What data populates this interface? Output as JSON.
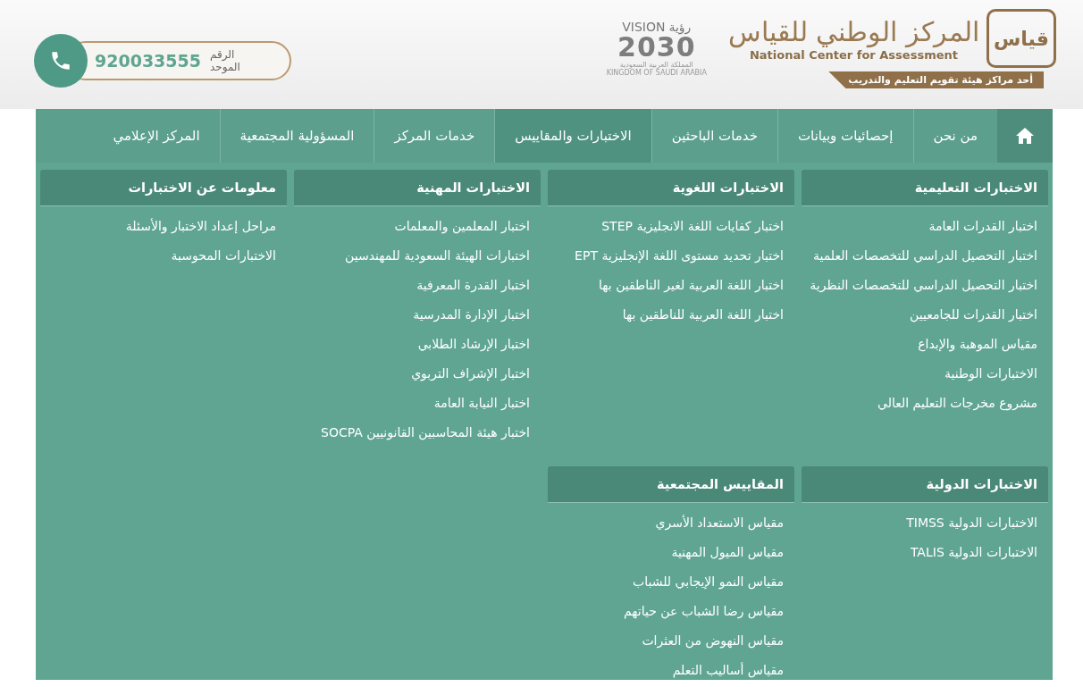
{
  "header": {
    "phone": {
      "label": "الرقم الموحد",
      "number": "920033555"
    },
    "vision": {
      "word_en": "VISION",
      "word_ar": "رؤية",
      "year": "2030",
      "country_ar": "المملكة العربية السعودية",
      "country_en": "KINGDOM OF SAUDI ARABIA"
    },
    "logo": {
      "mark": "قياس",
      "name_ar": "المركز الوطني للقياس",
      "name_en": "National Center for Assessment",
      "tagline": "أحد مراكز هيئة تقويم التعليم والتدريب"
    }
  },
  "nav": {
    "items": [
      {
        "label": "من نحن",
        "selected": false
      },
      {
        "label": "إحصائيات وبيانات",
        "selected": false
      },
      {
        "label": "خدمات الباحثين",
        "selected": false
      },
      {
        "label": "الاختبارات والمقاييس",
        "selected": true
      },
      {
        "label": "خدمات المركز",
        "selected": false
      },
      {
        "label": "المسؤولية المجتمعية",
        "selected": false
      },
      {
        "label": "المركز الإعلامي",
        "selected": false
      }
    ]
  },
  "mega_menu": {
    "sections": [
      {
        "title": "الاختبارات التعليمية",
        "items": [
          "اختبار القدرات العامة",
          "اختبار التحصيل الدراسي للتخصصات العلمية",
          "اختبار التحصيل الدراسي للتخصصات النظرية",
          "اختبار القدرات للجامعيين",
          "مقياس الموهبة والإبداع",
          "الاختبارات الوطنية",
          "مشروع مخرجات التعليم العالي"
        ]
      },
      {
        "title": "الاختبارات اللغوية",
        "items": [
          "اختبار كفايات اللغة الانجليزية STEP",
          "اختبار تحديد مستوى اللغة الإنجليزية EPT",
          "اختبار اللغة العربية لغير الناطقين بها",
          "اختبار اللغة العربية للناطقين بها"
        ]
      },
      {
        "title": "الاختبارات المهنية",
        "items": [
          "اختبار المعلمين والمعلمات",
          "اختبارات الهيئة السعودية للمهندسين",
          "اختبار القدرة المعرفية",
          "اختبار الإدارة المدرسية",
          "اختبار الإرشاد الطلابي",
          "اختبار الإشراف التربوي",
          "اختبار النيابة العامة",
          "اختبار هيئة المحاسبين القانونيين SOCPA"
        ]
      },
      {
        "title": "معلومات عن الاختبارات",
        "items": [
          "مراحل إعداد الاختبار والأسئلة",
          "الاختبارات المحوسبة"
        ]
      },
      {
        "title": "الاختبارات الدولية",
        "items": [
          "الاختبارات الدولية TIMSS",
          "الاختبارات الدولية TALIS"
        ]
      },
      {
        "title": "المقاييس المجتمعية",
        "items": [
          "مقياس الاستعداد الأسري",
          "مقياس الميول المهنية",
          "مقياس النمو الإيجابي للشباب",
          "مقياس رضا الشباب عن حياتهم",
          "مقياس النهوض من العثرات",
          "مقياس أساليب التعلم"
        ]
      }
    ]
  }
}
